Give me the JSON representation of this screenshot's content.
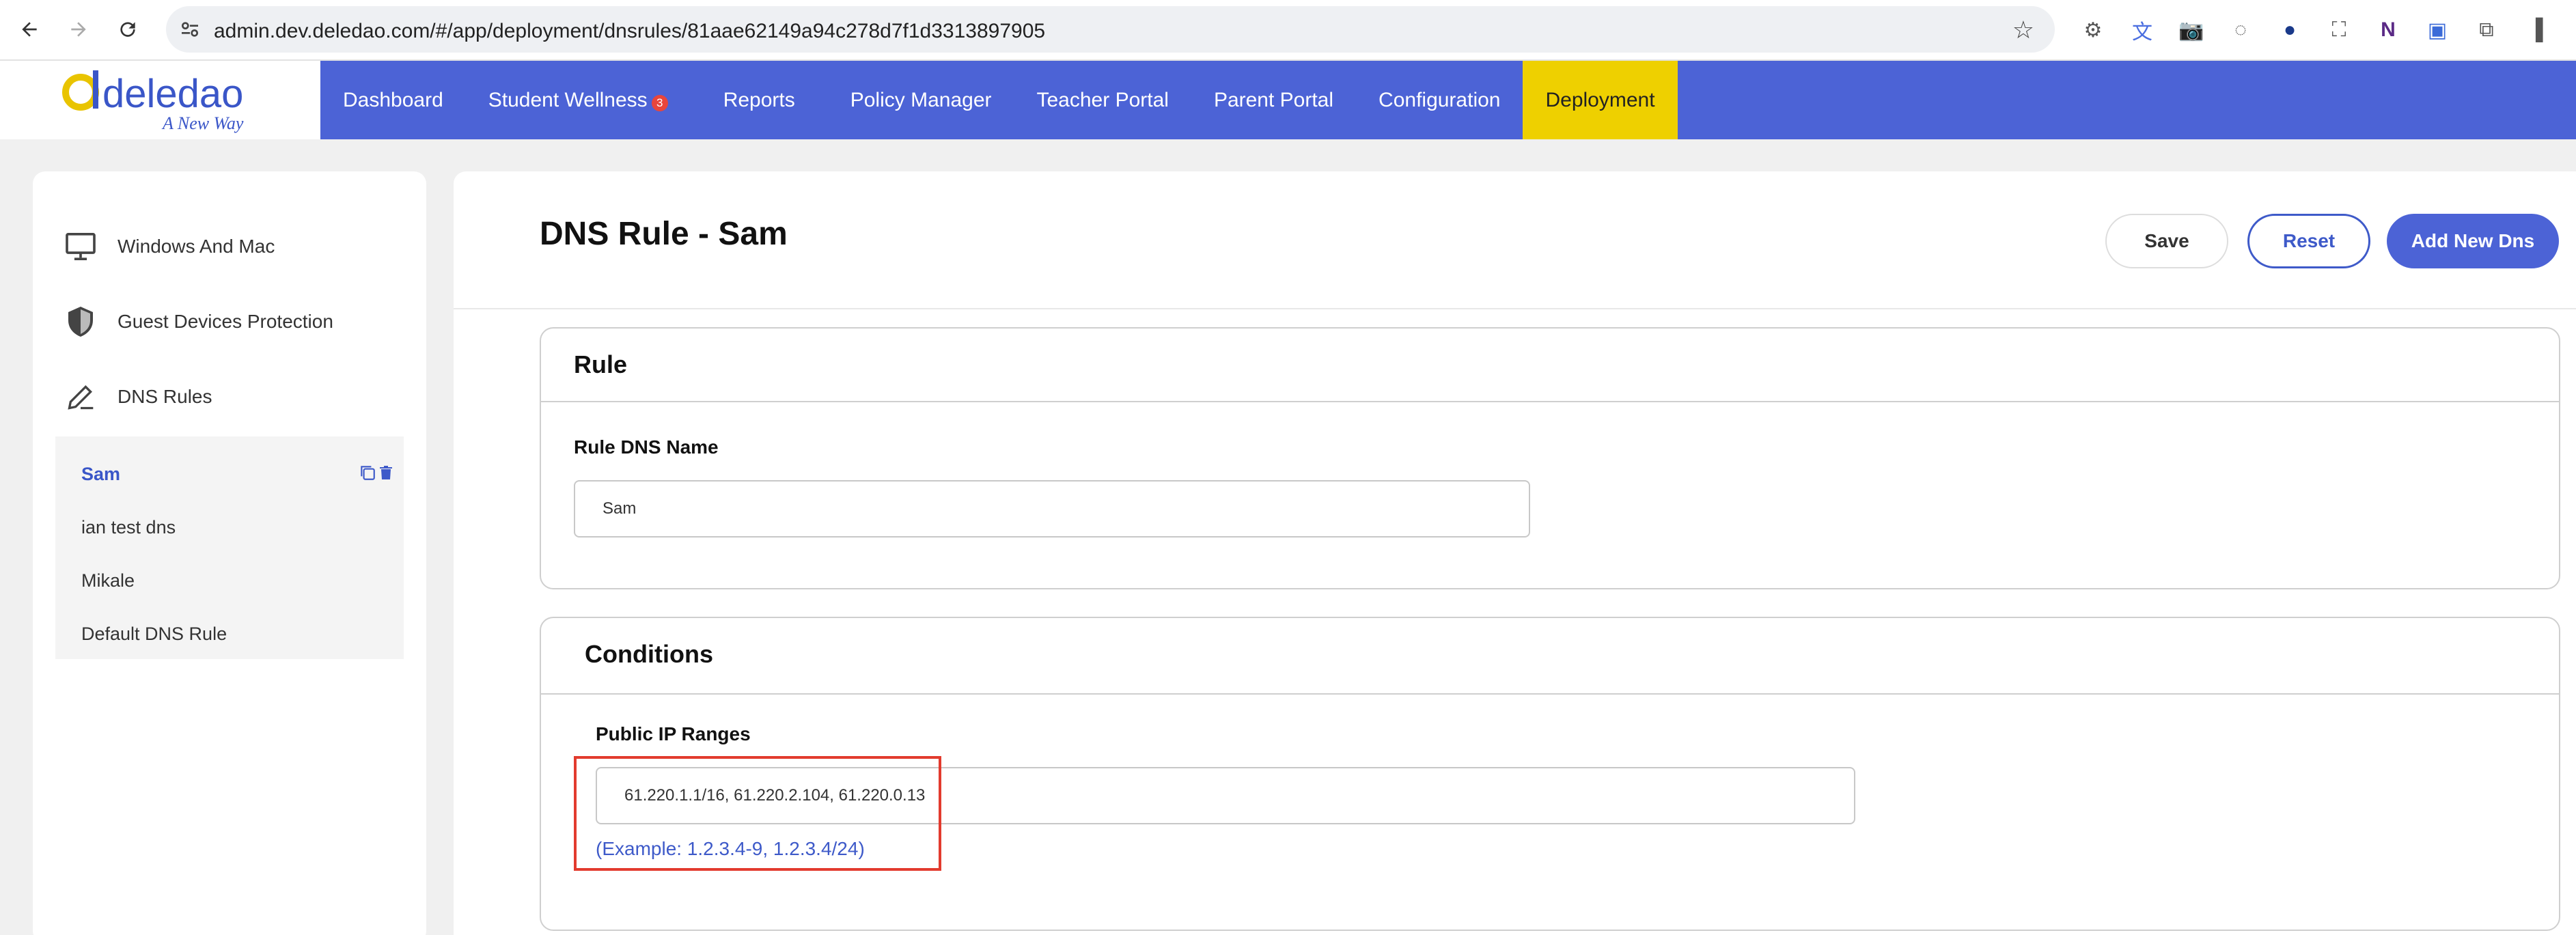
{
  "browser": {
    "url": "admin.dev.deledao.com/#/app/deployment/dnsrules/81aae62149a94c278d7f1d3313897905"
  },
  "logo": {
    "brand": "deledao",
    "tagline": "A New Way"
  },
  "menu": {
    "items": [
      {
        "label": "Dashboard"
      },
      {
        "label": "Student Wellness",
        "badge": "3"
      },
      {
        "label": "Reports"
      },
      {
        "label": "Policy Manager"
      },
      {
        "label": "Teacher Portal"
      },
      {
        "label": "Parent Portal"
      },
      {
        "label": "Configuration"
      },
      {
        "label": "Deployment",
        "active": true
      }
    ]
  },
  "sidebar": {
    "items": [
      {
        "label": "Windows And Mac",
        "icon": "monitor-icon"
      },
      {
        "label": "Guest Devices Protection",
        "icon": "shield-icon"
      },
      {
        "label": "DNS Rules",
        "icon": "pencil-icon"
      }
    ],
    "dns_rules": [
      {
        "label": "Sam",
        "selected": true
      },
      {
        "label": "ian test dns"
      },
      {
        "label": "Mikale"
      },
      {
        "label": "Default DNS Rule"
      }
    ]
  },
  "main": {
    "title": "DNS Rule - Sam",
    "buttons": {
      "save": "Save",
      "reset": "Reset",
      "add": "Add New Dns"
    },
    "rule_section": {
      "title": "Rule",
      "name_label": "Rule DNS Name",
      "name_value": "Sam"
    },
    "conditions_section": {
      "title": "Conditions",
      "ip_label": "Public IP Ranges",
      "ip_value": "61.220.1.1/16, 61.220.2.104, 61.220.0.13",
      "example": "(Example: 1.2.3.4-9, 1.2.3.4/24)"
    }
  },
  "colors": {
    "menu_bg": "#4c63d6",
    "active_tab": "#eed000",
    "accent": "#3e5ac9",
    "highlight": "#e23b2e"
  }
}
